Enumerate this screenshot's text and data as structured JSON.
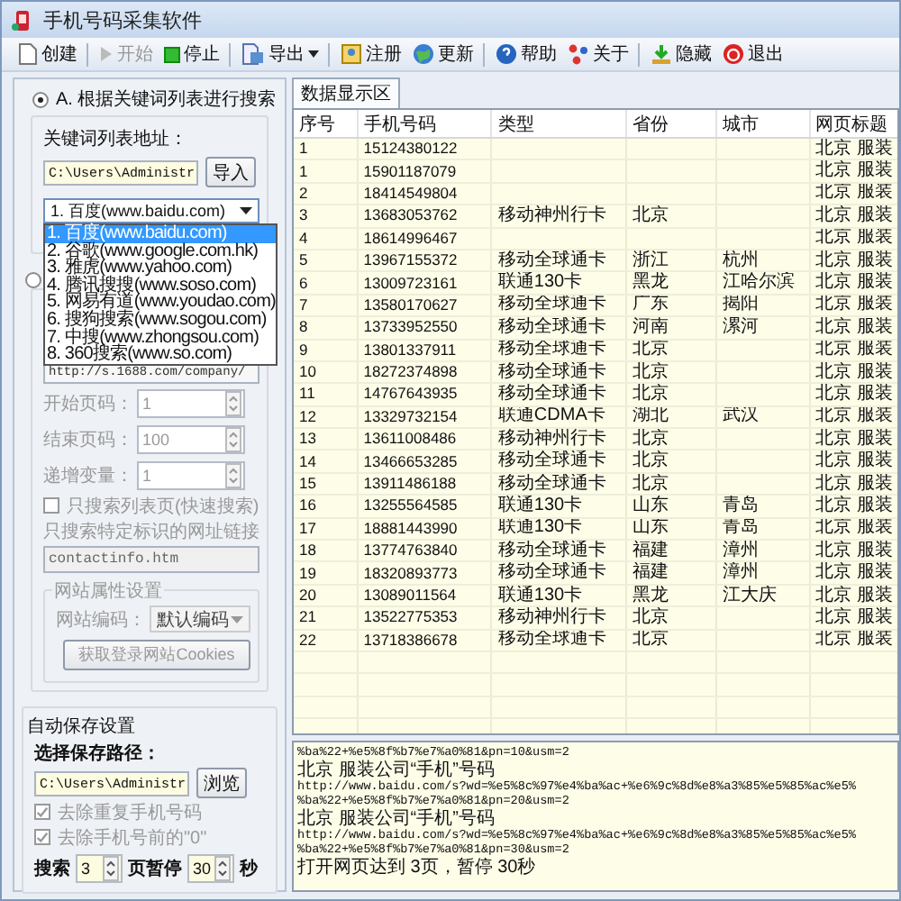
{
  "window": {
    "title": "手机号码采集软件"
  },
  "toolbar": [
    {
      "label": "创建",
      "kind": "new",
      "disabled": false,
      "separator_after": true,
      "has_menu": false
    },
    {
      "label": "开始",
      "kind": "play",
      "disabled": true,
      "separator_after": false,
      "has_menu": false
    },
    {
      "label": "停止",
      "kind": "stop",
      "disabled": false,
      "separator_after": true,
      "has_menu": false
    },
    {
      "label": "导出",
      "kind": "export",
      "disabled": false,
      "separator_after": true,
      "has_menu": true
    },
    {
      "label": "注册",
      "kind": "register",
      "disabled": false,
      "separator_after": false,
      "has_menu": false
    },
    {
      "label": "更新",
      "kind": "update",
      "disabled": false,
      "separator_after": true,
      "has_menu": false
    },
    {
      "label": "帮助",
      "kind": "help",
      "disabled": false,
      "separator_after": false,
      "has_menu": false
    },
    {
      "label": "关于",
      "kind": "about",
      "disabled": false,
      "separator_after": true,
      "has_menu": false
    },
    {
      "label": "隐藏",
      "kind": "hide",
      "disabled": false,
      "separator_after": false,
      "has_menu": false
    },
    {
      "label": "退出",
      "kind": "exit",
      "disabled": false,
      "separator_after": false,
      "has_menu": false
    }
  ],
  "mode_a": {
    "label": "A. 根据关键词列表进行搜索",
    "selected": true
  },
  "keyword_group": {
    "title": "关键词列表地址：",
    "path": "C:\\Users\\Administr",
    "import_button": "导入",
    "engine_select": {
      "value": "1. 百度(www.baidu.com)",
      "expanded": true,
      "options": [
        {
          "label": "1. 百度(www.baidu.com)",
          "selected": true
        },
        {
          "label": "2. 谷歌(www.google.com.hk)",
          "selected": false
        },
        {
          "label": "3. 雅虎(www.yahoo.com)",
          "selected": false
        },
        {
          "label": "4. 腾讯搜搜(www.soso.com)",
          "selected": false
        },
        {
          "label": "5. 网易有道(www.youdao.com)",
          "selected": false
        },
        {
          "label": "6. 搜狗搜索(www.sogou.com)",
          "selected": false
        },
        {
          "label": "7. 中搜(www.zhongsou.com)",
          "selected": false
        },
        {
          "label": "8. 360搜索(www.so.com)",
          "selected": false
        }
      ]
    }
  },
  "mode_b": {
    "selected": false
  },
  "url_field": {
    "value": "http://s.1688.com/company/"
  },
  "spinners": [
    {
      "label": "开始页码：",
      "value": "1",
      "disabled": true
    },
    {
      "label": "结束页码：",
      "value": "100",
      "disabled": true
    },
    {
      "label": "递增变量：",
      "value": "1",
      "disabled": true
    }
  ],
  "list_only": {
    "label": "只搜索列表页(快速搜索)",
    "checked": false,
    "disabled": true
  },
  "link_filter": {
    "label": "只搜索特定标识的网址链接",
    "value": "contactinfo.htm",
    "disabled": true
  },
  "site_group": {
    "title": "网站属性设置",
    "encoding_label": "网站编码：",
    "encoding_value": "默认编码",
    "cookies_button": "获取登录网站Cookies",
    "disabled": true
  },
  "autosave": {
    "title": "自动保存设置",
    "path_label": "选择保存路径：",
    "path": "C:\\Users\\Administr",
    "browse_button": "浏览",
    "options": [
      {
        "label": "去除重复手机号码",
        "checked": true,
        "disabled": true
      },
      {
        "label": "去除手机号前的\"0\"",
        "checked": true,
        "disabled": true
      }
    ],
    "pages_label": "搜索",
    "pages": "3",
    "pause_label": "页暂停",
    "pause": "30",
    "seconds_label": "秒"
  },
  "tabs": [
    {
      "label": "数据显示区",
      "selected": true
    }
  ],
  "table": {
    "columns": [
      "序号",
      "手机号码",
      "类型",
      "省份",
      "城市",
      "网页标题"
    ],
    "rows": [
      {
        "no": "1",
        "phone": "15124380122",
        "title": "北京 服装"
      },
      {
        "no": "1",
        "phone": "15901187079",
        "title": "北京 服装"
      },
      {
        "no": "2",
        "phone": "18414549804",
        "title": "北京 服装"
      },
      {
        "no": "3",
        "phone": "13683053762",
        "type": "移动神州行卡",
        "province": "北京",
        "title": "北京 服装"
      },
      {
        "no": "4",
        "phone": "18614996467",
        "title": "北京 服装"
      },
      {
        "no": "5",
        "phone": "13967155372",
        "type": "移动全球通卡",
        "province": "浙江",
        "city": "杭州",
        "title": "北京 服装"
      },
      {
        "no": "6",
        "phone": "13009723161",
        "type": "联通130卡",
        "province": "黑龙",
        "city": "江哈尔滨",
        "title": "北京 服装"
      },
      {
        "no": "7",
        "phone": "13580170627",
        "type": "移动全球通卡",
        "province": "广东",
        "city": "揭阳",
        "title": "北京 服装"
      },
      {
        "no": "8",
        "phone": "13733952550",
        "type": "移动全球通卡",
        "province": "河南",
        "city": "漯河",
        "title": "北京 服装"
      },
      {
        "no": "9",
        "phone": "13801337911",
        "type": "移动全球通卡",
        "province": "北京",
        "title": "北京 服装"
      },
      {
        "no": "10",
        "phone": "18272374898",
        "type": "移动全球通卡",
        "province": "北京",
        "title": "北京 服装"
      },
      {
        "no": "11",
        "phone": "14767643935",
        "type": "移动全球通卡",
        "province": "北京",
        "title": "北京 服装"
      },
      {
        "no": "12",
        "phone": "13329732154",
        "type": "联通CDMA卡",
        "province": "湖北",
        "city": "武汉",
        "title": "北京 服装"
      },
      {
        "no": "13",
        "phone": "13611008486",
        "type": "移动神州行卡",
        "province": "北京",
        "title": "北京 服装"
      },
      {
        "no": "14",
        "phone": "13466653285",
        "type": "移动全球通卡",
        "province": "北京",
        "title": "北京 服装"
      },
      {
        "no": "15",
        "phone": "13911486188",
        "type": "移动全球通卡",
        "province": "北京",
        "title": "北京 服装"
      },
      {
        "no": "16",
        "phone": "13255564585",
        "type": "联通130卡",
        "province": "山东",
        "city": "青岛",
        "title": "北京 服装"
      },
      {
        "no": "17",
        "phone": "18881443990",
        "type": "联通130卡",
        "province": "山东",
        "city": "青岛",
        "title": "北京 服装"
      },
      {
        "no": "18",
        "phone": "13774763840",
        "type": "移动全球通卡",
        "province": "福建",
        "city": "漳州",
        "title": "北京 服装"
      },
      {
        "no": "19",
        "phone": "18320893773",
        "type": "移动全球通卡",
        "province": "福建",
        "city": "漳州",
        "title": "北京 服装"
      },
      {
        "no": "20",
        "phone": "13089011564",
        "type": "联通130卡",
        "province": "黑龙",
        "city": "江大庆",
        "title": "北京 服装"
      },
      {
        "no": "21",
        "phone": "13522775353",
        "type": "移动神州行卡",
        "province": "北京",
        "title": "北京 服装"
      },
      {
        "no": "22",
        "phone": "13718386678",
        "type": "移动全球通卡",
        "province": "北京",
        "title": "北京 服装"
      }
    ]
  },
  "log": [
    {
      "kind": "url",
      "text": "%ba%22+%e5%8f%b7%e7%a0%81&pn=10&usm=2"
    },
    {
      "kind": "message",
      "text": "北京 服装公司“手机”号码"
    },
    {
      "kind": "url",
      "text": "http://www.baidu.com/s?wd=%e5%8c%97%e4%ba%ac+%e6%9c%8d%e8%a3%85%e5%85%ac%e5%"
    },
    {
      "kind": "url",
      "text": "%ba%22+%e5%8f%b7%e7%a0%81&pn=20&usm=2"
    },
    {
      "kind": "message",
      "text": "北京 服装公司“手机”号码"
    },
    {
      "kind": "url",
      "text": "http://www.baidu.com/s?wd=%e5%8c%97%e4%ba%ac+%e6%9c%8d%e8%a3%85%e5%85%ac%e5%"
    },
    {
      "kind": "url",
      "text": "%ba%22+%e5%8f%b7%e7%a0%81&pn=30&usm=2"
    },
    {
      "kind": "message",
      "text": "打开网页达到 3页，暂停 30秒"
    }
  ]
}
